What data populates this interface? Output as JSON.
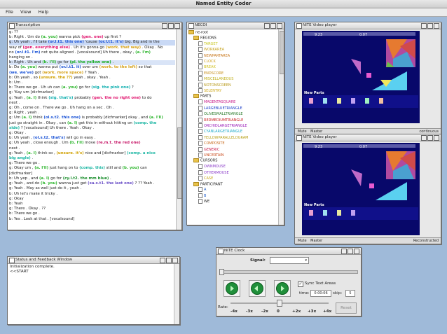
{
  "app": {
    "title": "Named Entity Coder"
  },
  "menu": [
    "File",
    "View",
    "Help"
  ],
  "transcription": {
    "title": "Transcription",
    "lines": [
      [
        {
          "t": "g: ??"
        }
      ],
      [
        {
          "t": "b: Right . Um do "
        },
        {
          "t": "(a. you)",
          "c": "c-you"
        },
        {
          "t": " wanna pick "
        },
        {
          "t": "(gen. one)",
          "c": "c-gen"
        },
        {
          "t": " up first ?"
        }
      ],
      [
        {
          "t": "g: Uh yeah , I'll take "
        },
        {
          "t": "(or.l.t1. this one)",
          "c": "c-orl"
        },
        {
          "t": " 'cause "
        },
        {
          "t": "(or.l.t1. it's)",
          "c": "c-orl"
        },
        {
          "t": " big. Big and in the"
        }
      ],
      [
        {
          "t": "way of "
        },
        {
          "t": "(gen. everything else)",
          "c": "c-gen"
        },
        {
          "t": " . Uh it's gonna go "
        },
        {
          "t": "(work. that way)",
          "c": "c-work"
        },
        {
          "t": " . Okay . No"
        }
      ],
      [
        {
          "t": "no "
        },
        {
          "t": "(or.l.t1. I'm)",
          "c": "c-orl"
        },
        {
          "t": " not quite aligned . [vocalsound] Uh there , okay , "
        },
        {
          "t": "(a. I'm)",
          "c": "c-you"
        }
      ],
      [
        {
          "t": "hanging on ."
        }
      ],
      [
        {
          "t": "b: Right . Uh and "
        },
        {
          "t": "(b. I'll)",
          "c": "c-you"
        },
        {
          "t": " go for "
        },
        {
          "t": "(pl. the yellow one)",
          "c": "c-pl"
        },
        {
          "t": " ."
        }
      ],
      [
        {
          "t": "b: Do "
        },
        {
          "t": "(a. you)",
          "c": "c-you"
        },
        {
          "t": " wanna put "
        },
        {
          "t": "(or.l.t1. it)",
          "c": "c-orl"
        },
        {
          "t": " over um "
        },
        {
          "t": "(work. to the left)",
          "c": "c-work"
        },
        {
          "t": " so that"
        }
      ],
      [
        {
          "t": "(we. we've)",
          "c": "c-orl"
        },
        {
          "t": " got "
        },
        {
          "t": "(work. more space)",
          "c": "c-work"
        },
        {
          "t": " ? Yeah ."
        }
      ],
      [
        {
          "t": "b: Oh yeah , so "
        },
        {
          "t": "(unsure. the ??)",
          "c": "c-unsure"
        },
        {
          "t": " yeah , okay . Yeah ."
        }
      ],
      [
        {
          "t": "b: Um ."
        }
      ],
      [
        {
          "t": "b: There we go . Uh uh can "
        },
        {
          "t": "(a. you)",
          "c": "c-you"
        },
        {
          "t": " go for "
        },
        {
          "t": "(sig. the pink one)",
          "c": "c-sig"
        },
        {
          "t": " ?"
        }
      ],
      [
        {
          "t": "g: 'Kay um [dicfmarker]"
        }
      ],
      [
        {
          "t": "g: Yeah , "
        },
        {
          "t": "(a. I)",
          "c": "c-you"
        },
        {
          "t": " think "
        },
        {
          "t": "(sig. that's)",
          "c": "c-sig"
        },
        {
          "t": " probably "
        },
        {
          "t": "(gen. the no right one)",
          "c": "c-gen"
        },
        {
          "t": " to do"
        }
      ],
      [
        {
          "t": "next ."
        }
      ],
      [
        {
          "t": "g: Oh , come on . There we go . Uh hang on a sec . Oh ."
        }
      ],
      [
        {
          "t": "g: Right , yeah ."
        }
      ],
      [
        {
          "t": "g: Um "
        },
        {
          "t": "(a. I)",
          "c": "c-you"
        },
        {
          "t": " think "
        },
        {
          "t": "(ol.s.t2. this one)",
          "c": "c-orl"
        },
        {
          "t": " is probably [dicfmarker] okay , and "
        },
        {
          "t": "(a. I'll)",
          "c": "c-you"
        }
      ],
      [
        {
          "t": "just go straight in . Okay , can "
        },
        {
          "t": "(a. I)",
          "c": "c-you"
        },
        {
          "t": " get this in without hitting on "
        },
        {
          "t": "(comp. the",
          "c": "c-comp"
        }
      ],
      [
        {
          "t": "side)",
          "c": "c-comp"
        },
        {
          "t": " ? [vocalsound] Uh there . Yeah . Okay ."
        }
      ],
      [
        {
          "t": "g: Okay ."
        }
      ],
      [
        {
          "t": "b: Uh yeah , "
        },
        {
          "t": "(ol.s.t2. that's)",
          "c": "c-orl"
        },
        {
          "t": " will go in easy ."
        }
      ],
      [
        {
          "t": "g: Uh yeah , close enough . Um "
        },
        {
          "t": "(b. I'll)",
          "c": "c-you"
        },
        {
          "t": " move "
        },
        {
          "t": "(re.m.t. the red one)",
          "c": "c-rem"
        }
      ],
      [
        {
          "t": "next ."
        }
      ],
      [
        {
          "t": "g: Yeah , "
        },
        {
          "t": "(a. I)",
          "c": "c-you"
        },
        {
          "t": " think so , "
        },
        {
          "t": "(unsure. it's)",
          "c": "c-unsure"
        },
        {
          "t": " nice and [dicfmarker] "
        },
        {
          "t": "(comp. a nice",
          "c": "c-comp"
        }
      ],
      [
        {
          "t": "big angle)",
          "c": "c-comp"
        },
        {
          "t": " ."
        }
      ],
      [
        {
          "t": "g: There we go ."
        }
      ],
      [
        {
          "t": "g: Okay um , "
        },
        {
          "t": "(a. I'll)",
          "c": "c-you"
        },
        {
          "t": " just hang on to "
        },
        {
          "t": "(comp. this)",
          "c": "c-comp"
        },
        {
          "t": " still and "
        },
        {
          "t": "(b. you)",
          "c": "c-you"
        },
        {
          "t": " can"
        }
      ],
      [
        {
          "t": "[dicfmarker]"
        }
      ],
      [
        {
          "t": "b: Uh yep , and "
        },
        {
          "t": "(a. I)",
          "c": "c-you"
        },
        {
          "t": " go for "
        },
        {
          "t": "(cy.l.t2. the mm blue)",
          "c": "c-cy"
        },
        {
          "t": " ."
        }
      ],
      [
        {
          "t": "g: Yeah , and do "
        },
        {
          "t": "(b. you)",
          "c": "c-you"
        },
        {
          "t": " wanna just get "
        },
        {
          "t": "(sa.s.t1. the last one)",
          "c": "c-sa"
        },
        {
          "t": " ? ?? Yeah ."
        }
      ],
      [
        {
          "t": "g: Yeah . May as well just do it , yeah ."
        }
      ],
      [
        {
          "t": "b: Uh let's make it tricky ."
        }
      ],
      [
        {
          "t": "g: Okay"
        }
      ],
      [
        {
          "t": "b: Yeah"
        }
      ],
      [
        {
          "t": "g: There . Okay . ??"
        }
      ],
      [
        {
          "t": "b: There we go ."
        }
      ],
      [
        {
          "t": "b: Yes . Look at that . [vocalsound]"
        }
      ]
    ]
  },
  "necoi": {
    "title": "NECOI",
    "tree": [
      {
        "label": "ne-root",
        "depth": 0,
        "kind": "folder",
        "color": "#222"
      },
      {
        "label": "REGIONS",
        "depth": 1,
        "kind": "folder",
        "color": "#222"
      },
      {
        "label": "TARGET",
        "depth": 2,
        "kind": "leaf",
        "color": "#c6c61c"
      },
      {
        "label": "WORKAREA",
        "depth": 2,
        "kind": "leaf",
        "color": "#c6a21c"
      },
      {
        "label": "NEWPARTAREA",
        "depth": 2,
        "kind": "leaf",
        "color": "#c8781c"
      },
      {
        "label": "CLOCK",
        "depth": 2,
        "kind": "leaf",
        "color": "#d0a01c"
      },
      {
        "label": "BREAK",
        "depth": 2,
        "kind": "leaf",
        "color": "#d0c01c"
      },
      {
        "label": "ENDSCORE",
        "depth": 2,
        "kind": "leaf",
        "color": "#c8901c"
      },
      {
        "label": "MISCELLANEOUS",
        "depth": 2,
        "kind": "leaf",
        "color": "#c0b01c"
      },
      {
        "label": "NOTONSCREEN",
        "depth": 2,
        "kind": "leaf",
        "color": "#b89a1c"
      },
      {
        "label": "SELENTRY",
        "depth": 2,
        "kind": "leaf",
        "color": "#d0aa1c"
      },
      {
        "label": "PARTS",
        "depth": 1,
        "kind": "folder",
        "color": "#222"
      },
      {
        "label": "MAGENTASQUARE",
        "depth": 2,
        "kind": "leaf",
        "color": "#c81c8a"
      },
      {
        "label": "LARGEBLUETRIANGLE",
        "depth": 2,
        "kind": "leaf",
        "color": "#1c3ec8"
      },
      {
        "label": "OLIVESMALLTRIANGLE",
        "depth": 2,
        "kind": "leaf",
        "color": "#2a7a2a"
      },
      {
        "label": "REDMEDIUMTRIANGLE",
        "depth": 2,
        "kind": "leaf",
        "color": "#c81c1c"
      },
      {
        "label": "ORCHIDLARGETRIANGLE",
        "depth": 2,
        "kind": "leaf",
        "color": "#9a1cb8"
      },
      {
        "label": "CYANLARGETRIANGLE",
        "depth": 2,
        "kind": "leaf",
        "color": "#1ca8c8"
      },
      {
        "label": "YELLOWPARALLELOGRAM",
        "depth": 2,
        "kind": "leaf",
        "color": "#b8a21c"
      },
      {
        "label": "COMPOSITE",
        "depth": 2,
        "kind": "leaf",
        "color": "#c86a1c"
      },
      {
        "label": "GENERIC",
        "depth": 2,
        "kind": "leaf",
        "color": "#c81c4a"
      },
      {
        "label": "UNCERTAIN",
        "depth": 2,
        "kind": "leaf",
        "color": "#c84a1c"
      },
      {
        "label": "CURSORS",
        "depth": 1,
        "kind": "folder",
        "color": "#222"
      },
      {
        "label": "OWNMOUSE",
        "depth": 2,
        "kind": "leaf",
        "color": "#8a3ac8"
      },
      {
        "label": "OTHERMOUSE",
        "depth": 2,
        "kind": "leaf",
        "color": "#8a3ac8"
      },
      {
        "label": "CASE",
        "depth": 2,
        "kind": "leaf",
        "color": "#c8a81c"
      },
      {
        "label": "PARTICIPANT",
        "depth": 1,
        "kind": "folder",
        "color": "#222"
      },
      {
        "label": "A",
        "depth": 2,
        "kind": "leaf",
        "color": "#1c5ac8"
      },
      {
        "label": "B",
        "depth": 2,
        "kind": "leaf",
        "color": "#1c5ac8"
      },
      {
        "label": "WE",
        "depth": 2,
        "kind": "leaf",
        "color": "#222"
      }
    ]
  },
  "video1": {
    "title": "NITE Video player",
    "score1": "9.23",
    "score2": "0.07",
    "new_parts": "New Parts",
    "mute": "Mute",
    "master": "Master",
    "status": "continuous"
  },
  "video2": {
    "title": "NITE Video player",
    "score1": "9.23",
    "score2": "0.07",
    "new_parts": "New Parts",
    "mute": "Mute",
    "master": "Master",
    "status": "Reconstructed"
  },
  "status_window": {
    "title": "Status and Feedback Window",
    "lines": [
      "Initialization complete.",
      "<<START"
    ]
  },
  "clock": {
    "title": "NITE Clock",
    "signal_label": "Signal:",
    "sync_label": "Sync Text Areas",
    "time_label": "time:",
    "time_value": "0:00:06",
    "skip_label": "skip:",
    "skip_value": "5",
    "rate_label": "Rate:",
    "rate_ticks": [
      "-4x",
      "-3x",
      "-2x",
      "0",
      "+2x",
      "+3x",
      "+4x"
    ],
    "reset_label": "Reset"
  }
}
